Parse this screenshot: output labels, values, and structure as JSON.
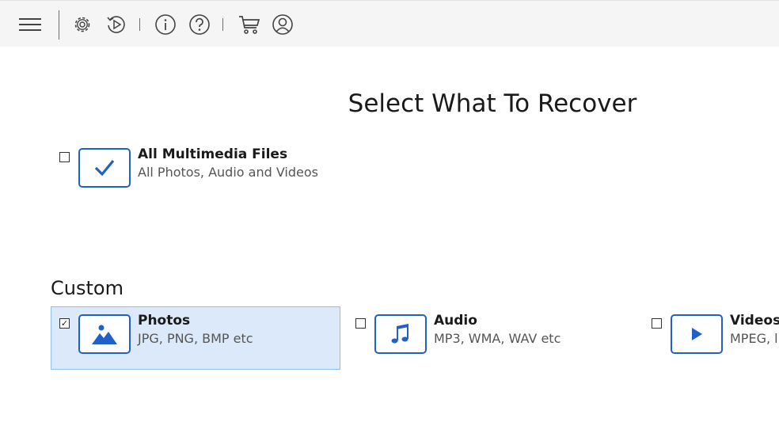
{
  "toolbar": {
    "icons": [
      "menu-icon",
      "gear-icon",
      "history-icon",
      "info-icon",
      "help-icon",
      "cart-icon",
      "account-icon"
    ]
  },
  "main": {
    "title": "Select What To Recover",
    "all_multimedia": {
      "label": "All Multimedia Files",
      "description": "All Photos, Audio and Videos",
      "checked": false,
      "icon": "checkmark-icon"
    },
    "custom_heading": "Custom",
    "options": [
      {
        "label": "Photos",
        "description": "JPG, PNG, BMP etc",
        "checked": true,
        "checkbox_mark": "✓",
        "icon": "image-icon"
      },
      {
        "label": "Audio",
        "description": "MP3, WMA, WAV etc",
        "checked": false,
        "icon": "music-note-icon"
      },
      {
        "label": "Videos",
        "description": "MPEG, l",
        "checked": false,
        "icon": "play-icon"
      }
    ]
  },
  "colors": {
    "accent": "#2160c8",
    "selected_bg": "#dbe9fa",
    "selected_border": "#8fc0ec",
    "toolbar_bg": "#f5f5f5"
  }
}
